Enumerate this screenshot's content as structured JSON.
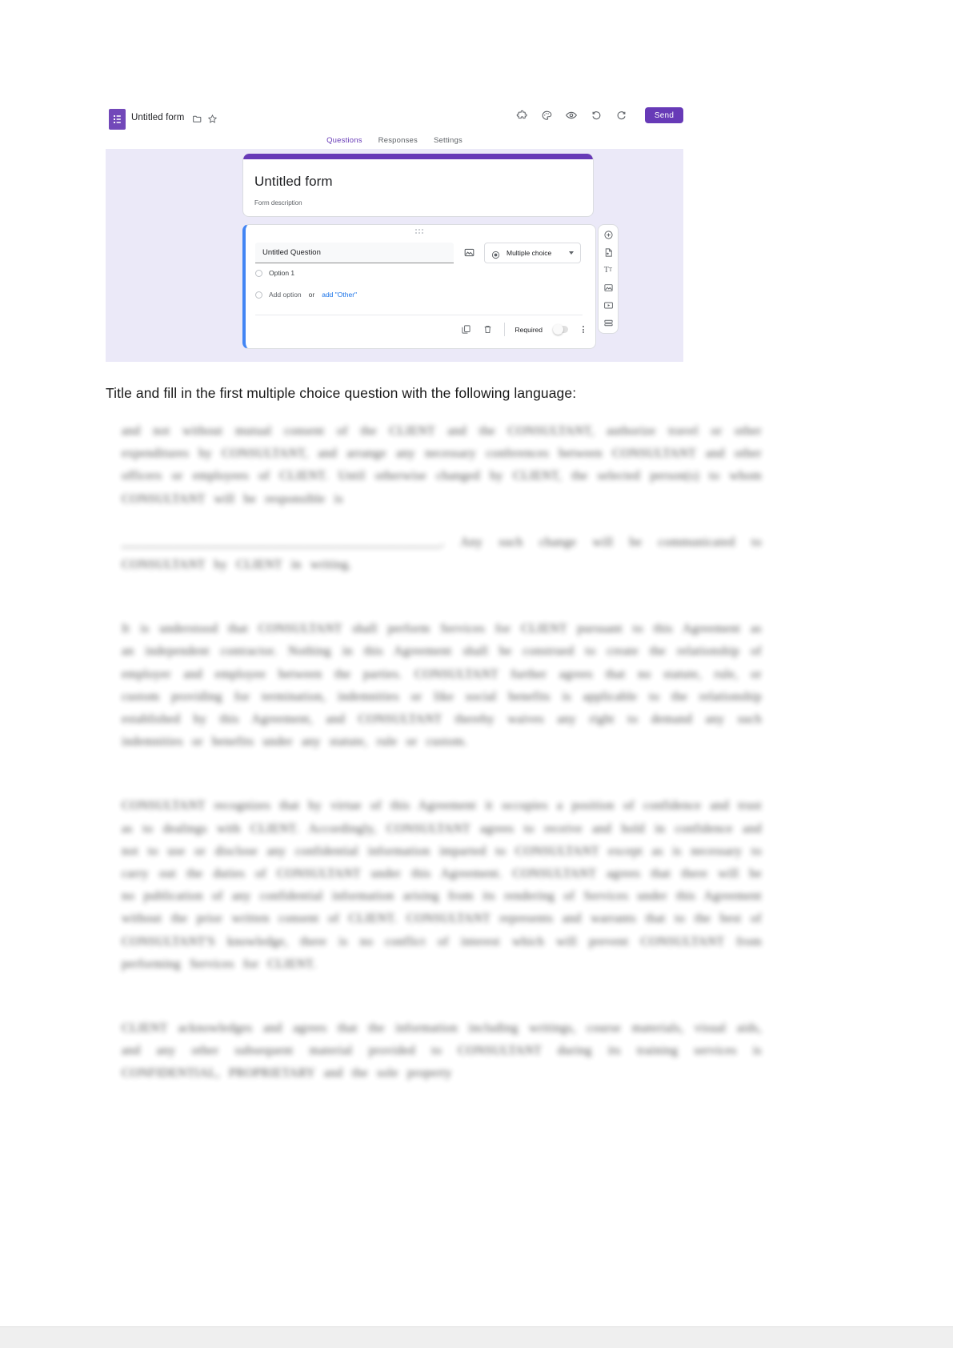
{
  "app": {
    "logo_icon": "google-forms-icon",
    "document_title": "Untitled form",
    "folder_icon": "folder-move-icon",
    "star_icon": "star-outline-icon"
  },
  "toolbar": {
    "icons": [
      {
        "name": "puzzle-addons-icon",
        "label": "Add-ons"
      },
      {
        "name": "palette-theme-icon",
        "label": "Customize theme"
      },
      {
        "name": "eye-preview-icon",
        "label": "Preview"
      },
      {
        "name": "undo-icon",
        "label": "Undo"
      },
      {
        "name": "redo-icon",
        "label": "Redo"
      }
    ],
    "send_label": "Send"
  },
  "tabs": [
    {
      "label": "Questions",
      "active": true
    },
    {
      "label": "Responses",
      "active": false
    },
    {
      "label": "Settings",
      "active": false
    }
  ],
  "form_header": {
    "title": "Untitled form",
    "description_placeholder": "Form description",
    "accent_color": "#673ab7"
  },
  "question": {
    "title_placeholder": "Untitled Question",
    "image_icon": "add-image-icon",
    "type_label": "Multiple choice",
    "type_icon": "radio-button-icon",
    "dropdown_icon": "chevron-down-icon",
    "drag_handle_icon": "drag-handle-dots-icon",
    "options": [
      {
        "label": "Option 1"
      }
    ],
    "add_option_label": "Add option",
    "or_label": "or",
    "add_other_label": "add \"Other\"",
    "footer": {
      "duplicate_icon": "duplicate-icon",
      "delete_icon": "trash-icon",
      "required_label": "Required",
      "required_on": false,
      "more_icon": "kebab-more-icon"
    },
    "accent_bar_color": "#4285f4"
  },
  "side_toolbar": [
    {
      "name": "add-question-icon",
      "label": "Add question"
    },
    {
      "name": "import-questions-icon",
      "label": "Import questions"
    },
    {
      "name": "add-title-description-icon",
      "label": "Add title and description"
    },
    {
      "name": "add-image-icon",
      "label": "Add image"
    },
    {
      "name": "add-video-icon",
      "label": "Add video"
    },
    {
      "name": "add-section-icon",
      "label": "Add section"
    }
  ],
  "instruction": {
    "text": "Title and fill in the first multiple choice question with the following language:"
  },
  "document": {
    "redacted": true,
    "paragraphs": [
      "and not without mutual consent of the CLIENT and the CONSULTANT, authorize travel or other expenditures by CONSULTANT, and arrange any necessary conferences between CONSULTANT and other officers or employees of CLIENT. Until otherwise changed by CLIENT, the selected person(s) to whom CONSULTANT will be responsible is",
      "_________________________________________________. Any such change will be communicated to CONSULTANT by CLIENT in writing.",
      "It is understood that CONSULTANT shall perform Services for CLIENT pursuant to this Agreement as an independent contractor. Nothing in this Agreement shall be construed to create the relationship of employer and employee between the parties. CONSULTANT further agrees that no statute, rule, or custom providing for termination, indemnities or like social benefits is applicable to the relationship established by this Agreement, and CONSULTANT thereby waives any right to demand any such indemnities or benefits under any statute, rule or custom.",
      "CONSULTANT recognizes that by virtue of this Agreement it occupies a position of confidence and trust as to dealings with CLIENT. Accordingly, CONSULTANT agrees to receive and hold in confidence and not to use or disclose any confidential information imparted to CONSULTANT except as is necessary to carry out the duties of CONSULTANT under this Agreement. CONSULTANT agrees that there will be no publication of any confidential information arising from its rendering of Services under this Agreement without the prior written consent of CLIENT. CONSULTANT represents and warrants that to the best of CONSULTANT'S knowledge, there is no conflict of interest which will prevent CONSULTANT from performing Services for CLIENT.",
      "CLIENT acknowledges and agrees that the information including writings, course materials, visual aids, and any other subsequent material provided to CONSULTANT during its training services is CONFIDENTIAL, PROPRIETARY and the sole property"
    ]
  }
}
